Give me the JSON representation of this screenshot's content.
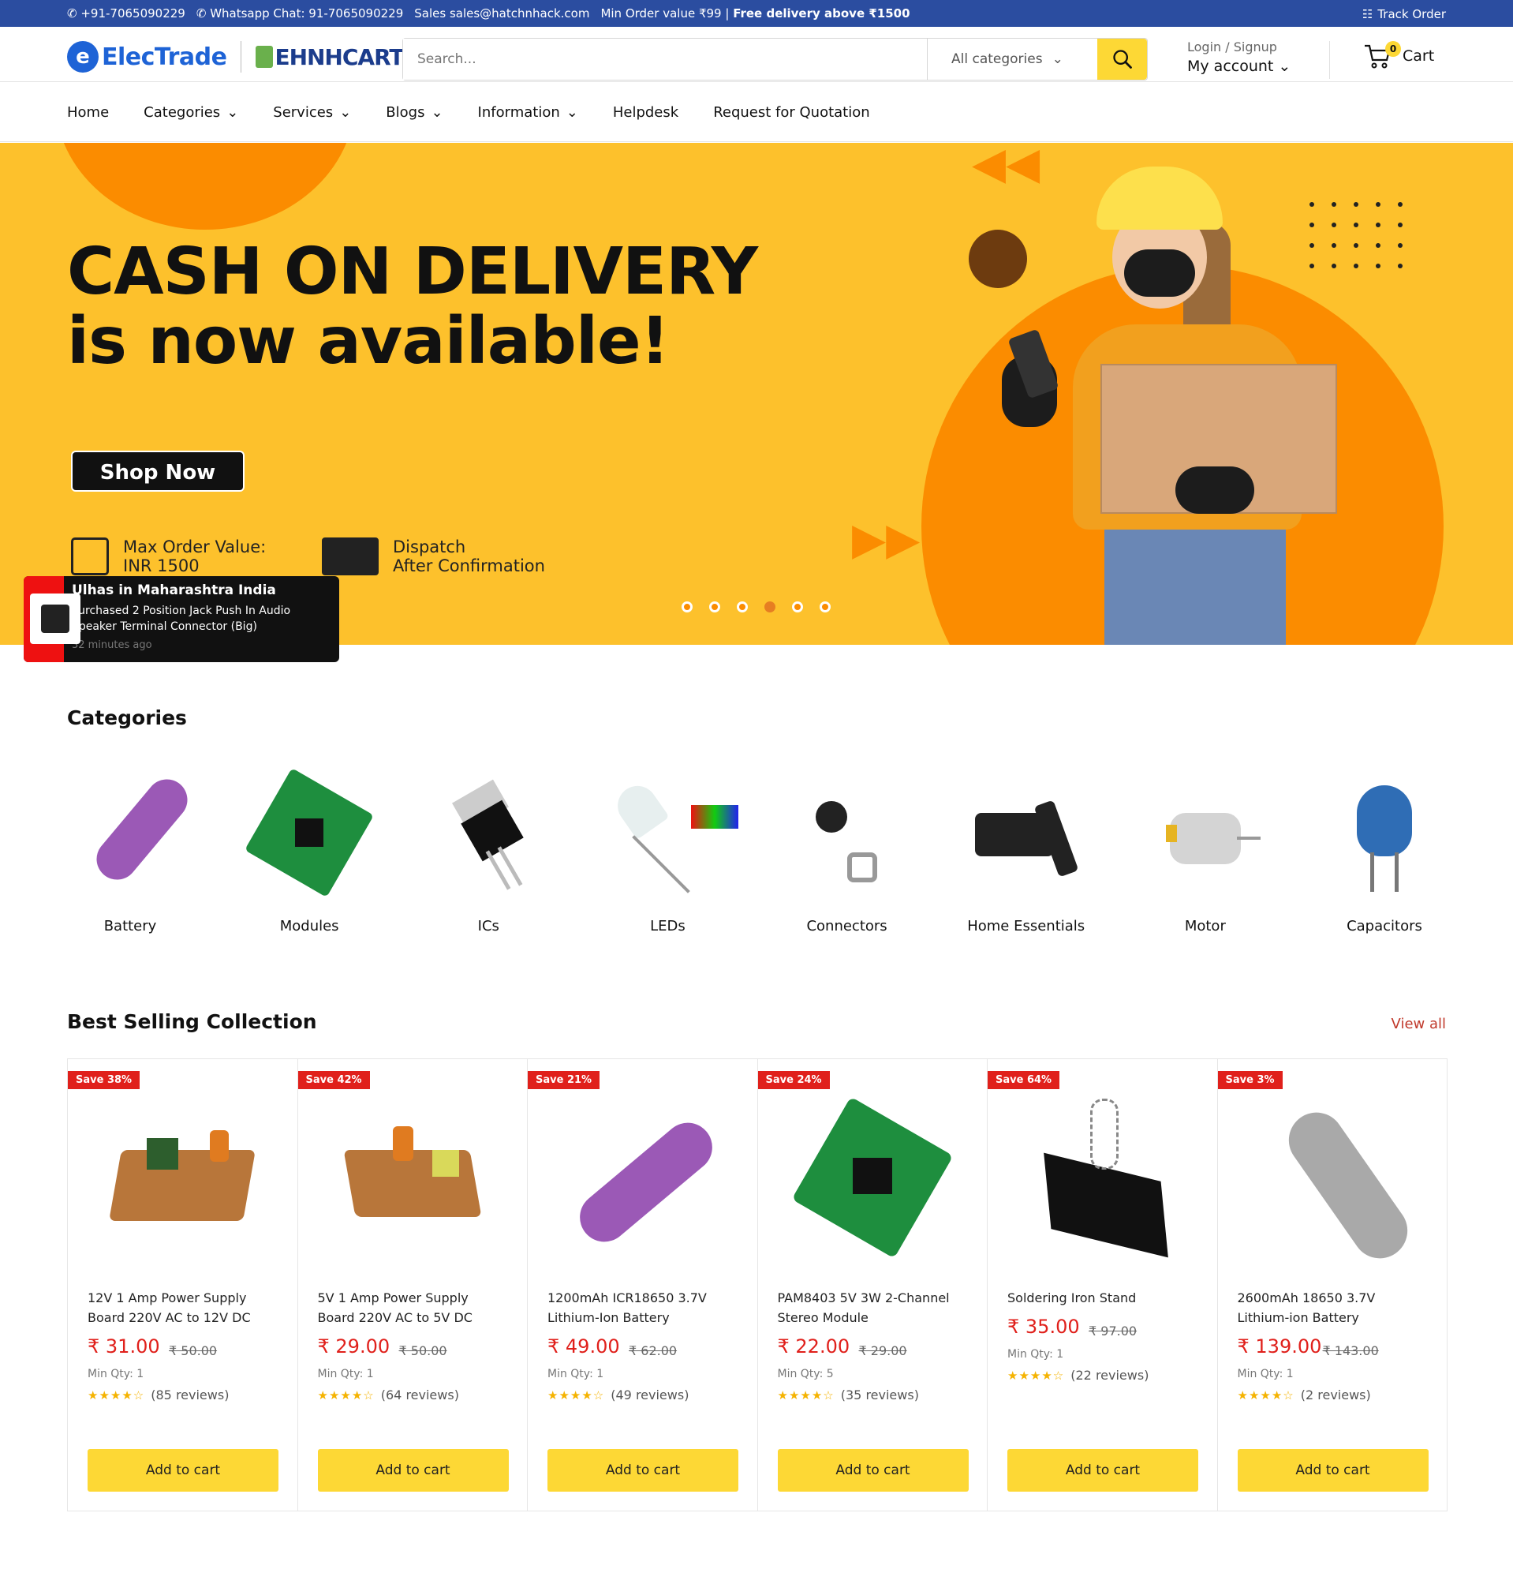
{
  "topbar": {
    "phone": "+91-7065090229",
    "whatsapp": "Whatsapp Chat: 91-7065090229",
    "sales": "Sales sales@hatchnhack.com",
    "min_order": "Min Order value ₹99 |",
    "free_delivery": "Free delivery above ₹1500",
    "track_order": "Track Order"
  },
  "header": {
    "brand": "ElecTrade",
    "brand2": "EHNHCART",
    "search_placeholder": "Search...",
    "category_select": "All categories",
    "login_label": "Login / Signup",
    "account_label": "My account",
    "cart_label": "Cart",
    "cart_count": "0"
  },
  "nav": [
    "Home",
    "Categories",
    "Services",
    "Blogs",
    "Information",
    "Helpdesk",
    "Request for Quotation"
  ],
  "banner": {
    "line1": "CASH ON DELIVERY",
    "line2": "is now available!",
    "cta": "Shop Now",
    "feature1_title": "Max Order Value:",
    "feature1_value": "INR 1500",
    "feature2_title": "Dispatch",
    "feature2_value": "After Confirmation"
  },
  "toast": {
    "name": "Ulhas in Maharashtra India",
    "message": "Purchased 2 Position Jack Push In Audio Speaker Terminal Connector (Big)",
    "time": "32 minutes ago"
  },
  "categories": {
    "title": "Categories",
    "items": [
      "Battery",
      "Modules",
      "ICs",
      "LEDs",
      "Connectors",
      "Home Essentials",
      "Motor",
      "Capacitors"
    ]
  },
  "best_selling": {
    "title": "Best Selling Collection",
    "view_all": "View all",
    "add_to_cart": "Add to cart",
    "products": [
      {
        "save": "Save 38%",
        "title": "12V 1 Amp Power Supply Board 220V AC to 12V DC",
        "price": "₹ 31.00",
        "old": "₹ 50.00",
        "min": "Min Qty: 1",
        "stars": "★★★★☆",
        "reviews": "(85 reviews)"
      },
      {
        "save": "Save 42%",
        "title": "5V 1 Amp Power Supply Board 220V AC to 5V DC",
        "price": "₹ 29.00",
        "old": "₹ 50.00",
        "min": "Min Qty: 1",
        "stars": "★★★★☆",
        "reviews": "(64 reviews)"
      },
      {
        "save": "Save 21%",
        "title": "1200mAh ICR18650 3.7V Lithium-Ion Battery",
        "price": "₹ 49.00",
        "old": "₹ 62.00",
        "min": "Min Qty: 1",
        "stars": "★★★★☆",
        "reviews": "(49 reviews)"
      },
      {
        "save": "Save 24%",
        "title": "PAM8403 5V 3W 2-Channel Stereo Module",
        "price": "₹ 22.00",
        "old": "₹ 29.00",
        "min": "Min Qty: 5",
        "stars": "★★★★☆",
        "reviews": "(35 reviews)"
      },
      {
        "save": "Save 64%",
        "title": "Soldering Iron Stand",
        "price": "₹ 35.00",
        "old": "₹ 97.00",
        "min": "Min Qty: 1",
        "stars": "★★★★☆",
        "reviews": "(22 reviews)"
      },
      {
        "save": "Save 3%",
        "title": "2600mAh 18650 3.7V Lithium-ion Battery",
        "price": "₹ 139.00",
        "old": "₹ 143.00",
        "min": "Min Qty: 1",
        "stars": "★★★★☆",
        "reviews": "(2 reviews)"
      }
    ]
  }
}
